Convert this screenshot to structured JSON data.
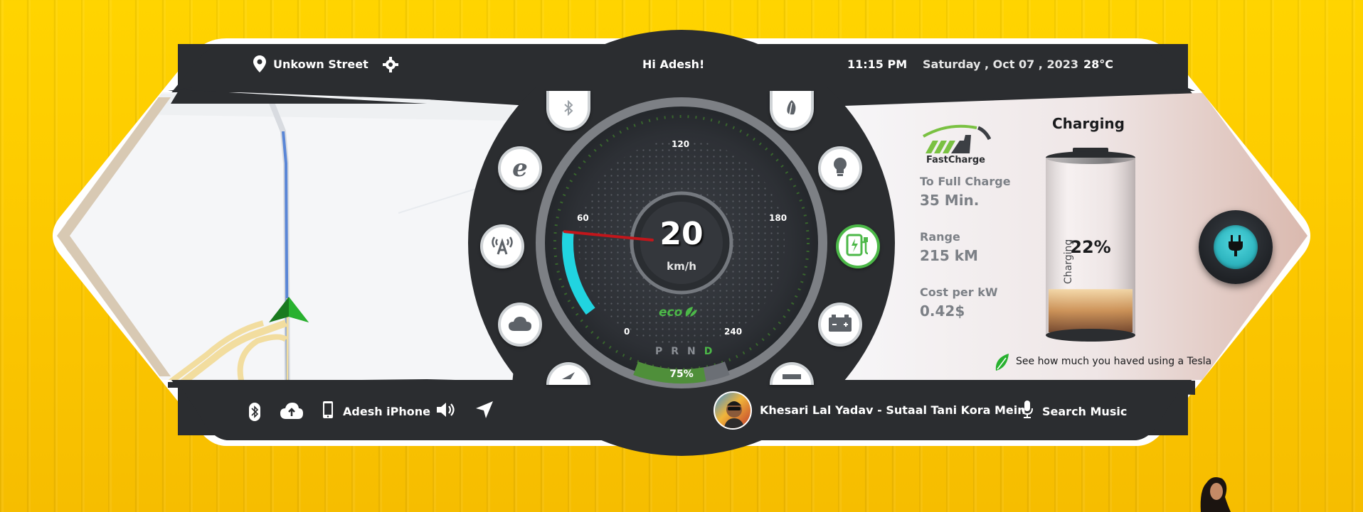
{
  "header": {
    "location": "Unkown Street",
    "greeting": "Hi Adesh!",
    "time": "11:15 PM",
    "date": "Saturday , Oct 07 , 2023",
    "temperature": "28°C"
  },
  "speedometer": {
    "speed": "20",
    "unit": "km/h",
    "ticks": [
      "0",
      "60",
      "120",
      "180",
      "240"
    ],
    "mode": "eco",
    "gears": [
      "P",
      "R",
      "N",
      "D"
    ],
    "active_gear": "D",
    "battery_percent_label": "75%",
    "battery_level": 0.75,
    "speed_value": 20,
    "speed_max": 240
  },
  "charging": {
    "brand": "FastCharge",
    "title": "Charging",
    "to_full_label": "To Full Charge",
    "to_full_value": "35 Min.",
    "range_label": "Range",
    "range_value": "215 kM",
    "cost_label": "Cost per kW",
    "cost_value": "0.42$",
    "battery_percent": "22%",
    "battery_status": "Charging",
    "battery_level": 0.22,
    "tesla_prompt": "See how much you haved using a Tesla"
  },
  "footer": {
    "device": "Adesh iPhone",
    "now_playing": "Khesari Lal Yadav - Sutaal Tani Kora Mein",
    "search_music": "Search Music"
  },
  "colors": {
    "background": "#FFD200",
    "panel_dark": "#2b2d30",
    "accent_green": "#4cb848",
    "accent_cyan": "#21d4e0",
    "needle_red": "#c2161b"
  },
  "icons": {
    "left_buttons": [
      "bluetooth-icon",
      "internet-explorer-icon",
      "antenna-icon",
      "cloud-icon",
      "send-icon"
    ],
    "right_buttons": [
      "leaf-icon",
      "bulb-icon",
      "ev-charger-icon",
      "battery-icon",
      "tray-icon"
    ]
  }
}
